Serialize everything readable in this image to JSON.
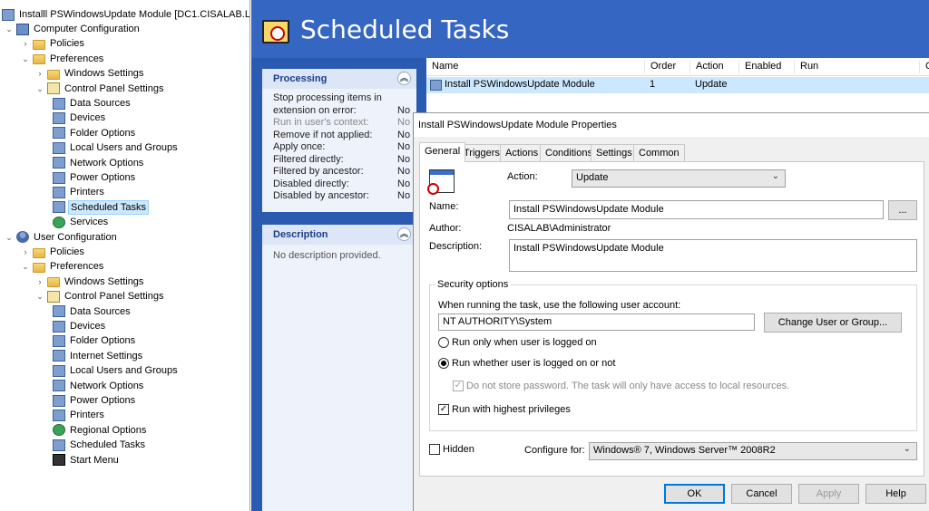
{
  "tree": {
    "root": "Installl PSWindowsUpdate Module [DC1.CISALAB.LO",
    "items": [
      {
        "label": "Computer Configuration",
        "level": 1,
        "chev": "v",
        "icon": "computer-icon"
      },
      {
        "label": "Policies",
        "level": 2,
        "chev": ">",
        "icon": "folder-icon"
      },
      {
        "label": "Preferences",
        "level": 2,
        "chev": "v",
        "icon": "folder-icon"
      },
      {
        "label": "Windows Settings",
        "level": 3,
        "chev": ">",
        "icon": "folder-icon"
      },
      {
        "label": "Control Panel Settings",
        "level": 3,
        "chev": "v",
        "icon": "control-panel-icon"
      },
      {
        "label": "Data Sources",
        "level": 4,
        "chev": "",
        "icon": "data-sources-icon"
      },
      {
        "label": "Devices",
        "level": 4,
        "chev": "",
        "icon": "devices-icon"
      },
      {
        "label": "Folder Options",
        "level": 4,
        "chev": "",
        "icon": "folder-options-icon"
      },
      {
        "label": "Local Users and Groups",
        "level": 4,
        "chev": "",
        "icon": "users-groups-icon"
      },
      {
        "label": "Network Options",
        "level": 4,
        "chev": "",
        "icon": "network-icon"
      },
      {
        "label": "Power Options",
        "level": 4,
        "chev": "",
        "icon": "power-icon"
      },
      {
        "label": "Printers",
        "level": 4,
        "chev": "",
        "icon": "printer-icon"
      },
      {
        "label": "Scheduled Tasks",
        "level": 4,
        "chev": "",
        "icon": "scheduled-tasks-icon",
        "selected": true
      },
      {
        "label": "Services",
        "level": 4,
        "chev": "",
        "icon": "services-icon"
      },
      {
        "label": "User Configuration",
        "level": 1,
        "chev": "v",
        "icon": "user-icon"
      },
      {
        "label": "Policies",
        "level": 2,
        "chev": ">",
        "icon": "folder-icon"
      },
      {
        "label": "Preferences",
        "level": 2,
        "chev": "v",
        "icon": "folder-icon"
      },
      {
        "label": "Windows Settings",
        "level": 3,
        "chev": ">",
        "icon": "folder-icon"
      },
      {
        "label": "Control Panel Settings",
        "level": 3,
        "chev": "v",
        "icon": "control-panel-icon"
      },
      {
        "label": "Data Sources",
        "level": 4,
        "chev": "",
        "icon": "data-sources-icon"
      },
      {
        "label": "Devices",
        "level": 4,
        "chev": "",
        "icon": "devices-icon"
      },
      {
        "label": "Folder Options",
        "level": 4,
        "chev": "",
        "icon": "folder-options-icon"
      },
      {
        "label": "Internet Settings",
        "level": 4,
        "chev": "",
        "icon": "internet-icon"
      },
      {
        "label": "Local Users and Groups",
        "level": 4,
        "chev": "",
        "icon": "users-groups-icon"
      },
      {
        "label": "Network Options",
        "level": 4,
        "chev": "",
        "icon": "network-icon"
      },
      {
        "label": "Power Options",
        "level": 4,
        "chev": "",
        "icon": "power-icon"
      },
      {
        "label": "Printers",
        "level": 4,
        "chev": "",
        "icon": "printer-icon"
      },
      {
        "label": "Regional Options",
        "level": 4,
        "chev": "",
        "icon": "regional-icon"
      },
      {
        "label": "Scheduled Tasks",
        "level": 4,
        "chev": "",
        "icon": "scheduled-tasks-icon"
      },
      {
        "label": "Start Menu",
        "level": 4,
        "chev": "",
        "icon": "start-menu-icon"
      }
    ]
  },
  "header": {
    "title": "Scheduled Tasks"
  },
  "processing": {
    "title": "Processing",
    "rows": [
      {
        "label": "Stop processing items in",
        "value": ""
      },
      {
        "label": "extension on error:",
        "value": "No"
      },
      {
        "label": "Run in user's context:",
        "value": "No",
        "dim": true
      },
      {
        "label": "Remove if not applied:",
        "value": "No"
      },
      {
        "label": "Apply once:",
        "value": "No"
      },
      {
        "label": "Filtered directly:",
        "value": "No"
      },
      {
        "label": "Filtered by ancestor:",
        "value": "No"
      },
      {
        "label": "Disabled directly:",
        "value": "No"
      },
      {
        "label": "Disabled by ancestor:",
        "value": "No"
      }
    ]
  },
  "description_panel": {
    "title": "Description",
    "text": "No description provided."
  },
  "list": {
    "columns": [
      "Name",
      "Order",
      "Action",
      "Enabled",
      "Run",
      "C"
    ],
    "rows": [
      {
        "name": "Install PSWindowsUpdate Module",
        "order": "1",
        "action": "Update"
      }
    ]
  },
  "dialog": {
    "title": "Install PSWindowsUpdate Module Properties",
    "tabs": [
      "General",
      "Triggers",
      "Actions",
      "Conditions",
      "Settings",
      "Common"
    ],
    "action_label": "Action:",
    "action_value": "Update",
    "name_label": "Name:",
    "name_value": "Install PSWindowsUpdate Module",
    "browse_label": "...",
    "author_label": "Author:",
    "author_value": "CISALAB\\Administrator",
    "description_label": "Description:",
    "description_value": "Install PSWindowsUpdate Module",
    "security": {
      "title": "Security options",
      "account_prompt": "When running the task, use the following user account:",
      "account_value": "NT AUTHORITY\\System",
      "change_button": "Change User or Group...",
      "radio_logged_on": "Run only when user is logged on",
      "radio_whether": "Run whether user is logged on or not",
      "no_store_password": "Do not store password. The task will only have access to local resources.",
      "highest_privileges": "Run with highest privileges"
    },
    "hidden_label": "Hidden",
    "configure_label": "Configure for:",
    "configure_value": "Windows® 7, Windows Server™ 2008R2",
    "buttons": {
      "ok": "OK",
      "cancel": "Cancel",
      "apply": "Apply",
      "help": "Help"
    }
  }
}
